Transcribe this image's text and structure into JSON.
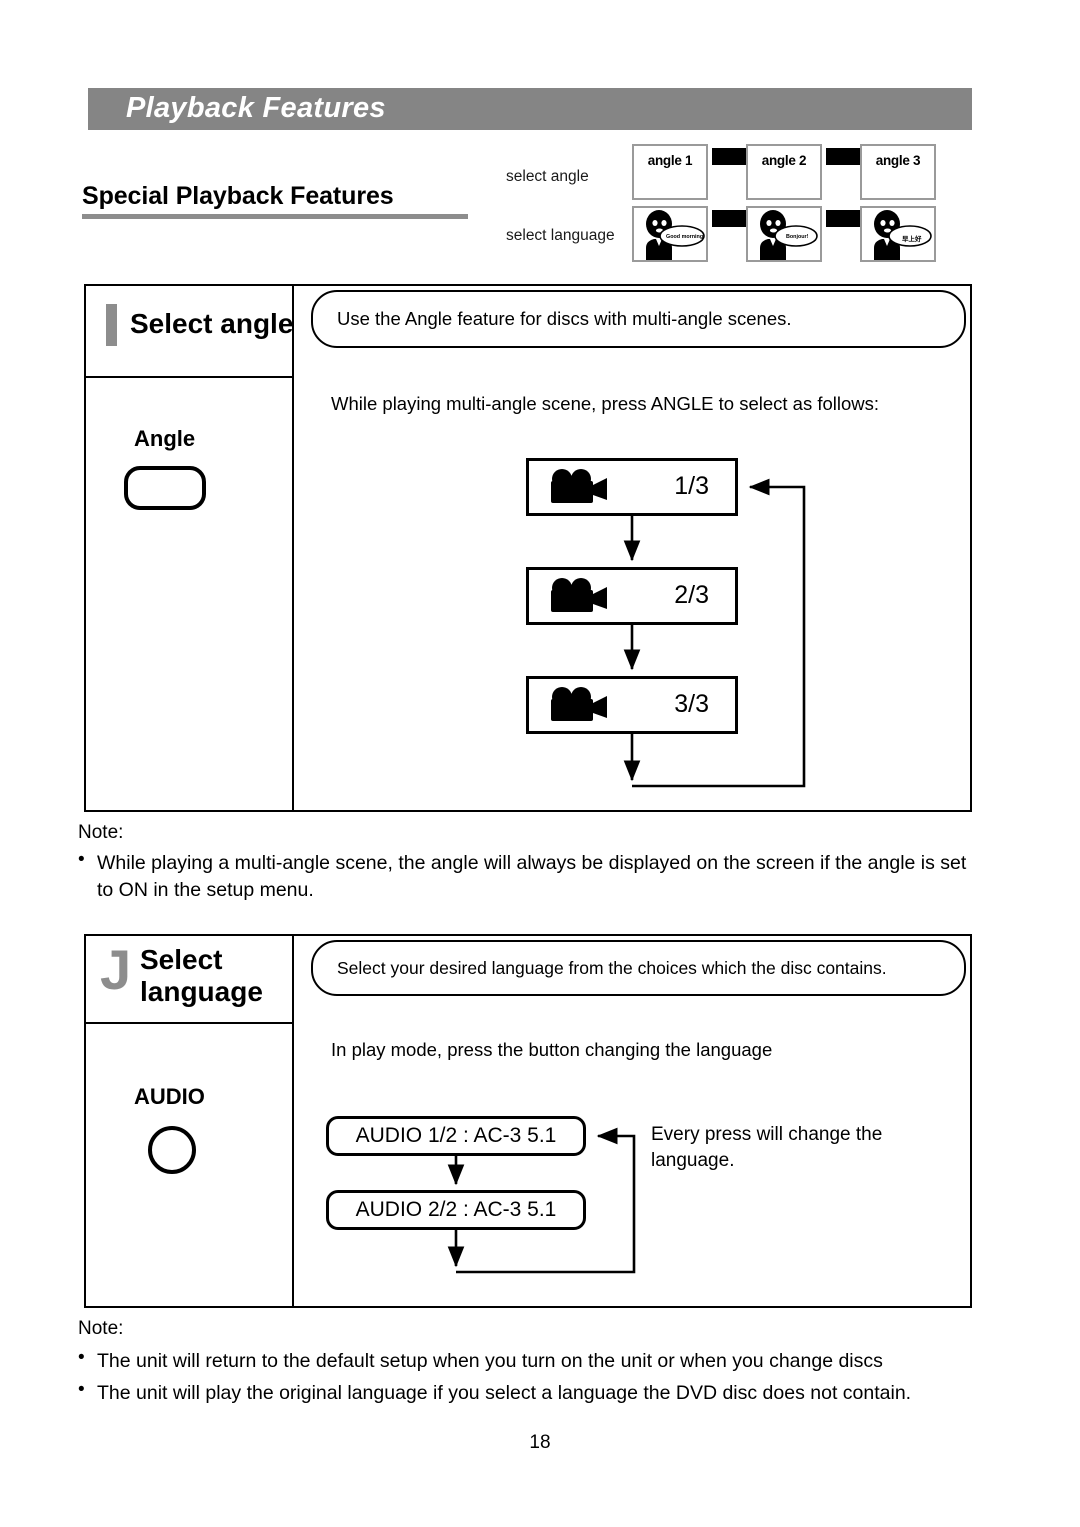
{
  "header": {
    "title": "Playback Features"
  },
  "section": {
    "heading": "Special Playback Features"
  },
  "illustration": {
    "row_labels": {
      "angle": "select angle",
      "language": "select language"
    },
    "angle_cells": [
      "angle 1",
      "angle 2",
      "angle 3"
    ],
    "language_bubbles": [
      "Good morning!",
      "Bonjour!",
      "早上好"
    ]
  },
  "angle_block": {
    "title": "Select angle",
    "mark": "vertical-gray-bar",
    "callout": "Use the Angle feature for discs with multi-angle scenes.",
    "instruction": "While playing multi-angle scene, press ANGLE to select as follows:",
    "button_label": "Angle",
    "flow": {
      "type": "cycle",
      "steps": [
        "1/3",
        "2/3",
        "3/3"
      ],
      "icon": "video-camera-icon",
      "loops_back_to_first": true
    }
  },
  "angle_note": {
    "label": "Note:",
    "items": [
      "While playing a multi-angle scene, the angle will always be displayed on the screen if the angle is set to ON in the setup menu."
    ]
  },
  "language_block": {
    "title_line1": "Select",
    "title_line2": "language",
    "mark": "J",
    "callout": "Select your desired language from the choices which the disc contains.",
    "instruction": "In play mode, press the button changing the language",
    "button_label": "AUDIO",
    "flow": {
      "type": "cycle",
      "steps": [
        "AUDIO 1/2 : AC-3 5.1",
        "AUDIO 2/2 : AC-3 5.1"
      ],
      "loops_back_to_first": true
    },
    "side_note": "Every press will change the language."
  },
  "language_note": {
    "label": "Note:",
    "items": [
      "The unit will return to the default setup when you turn on the unit or when you change discs",
      "The unit will play the original language if you select a language the DVD disc does not contain."
    ]
  },
  "footer": {
    "page_number": "18"
  },
  "colors": {
    "header_band": "#858585",
    "mark_gray": "#8d8d8d",
    "rule_gray": "#8d8d8d",
    "ink": "#000000",
    "paper": "#ffffff"
  }
}
